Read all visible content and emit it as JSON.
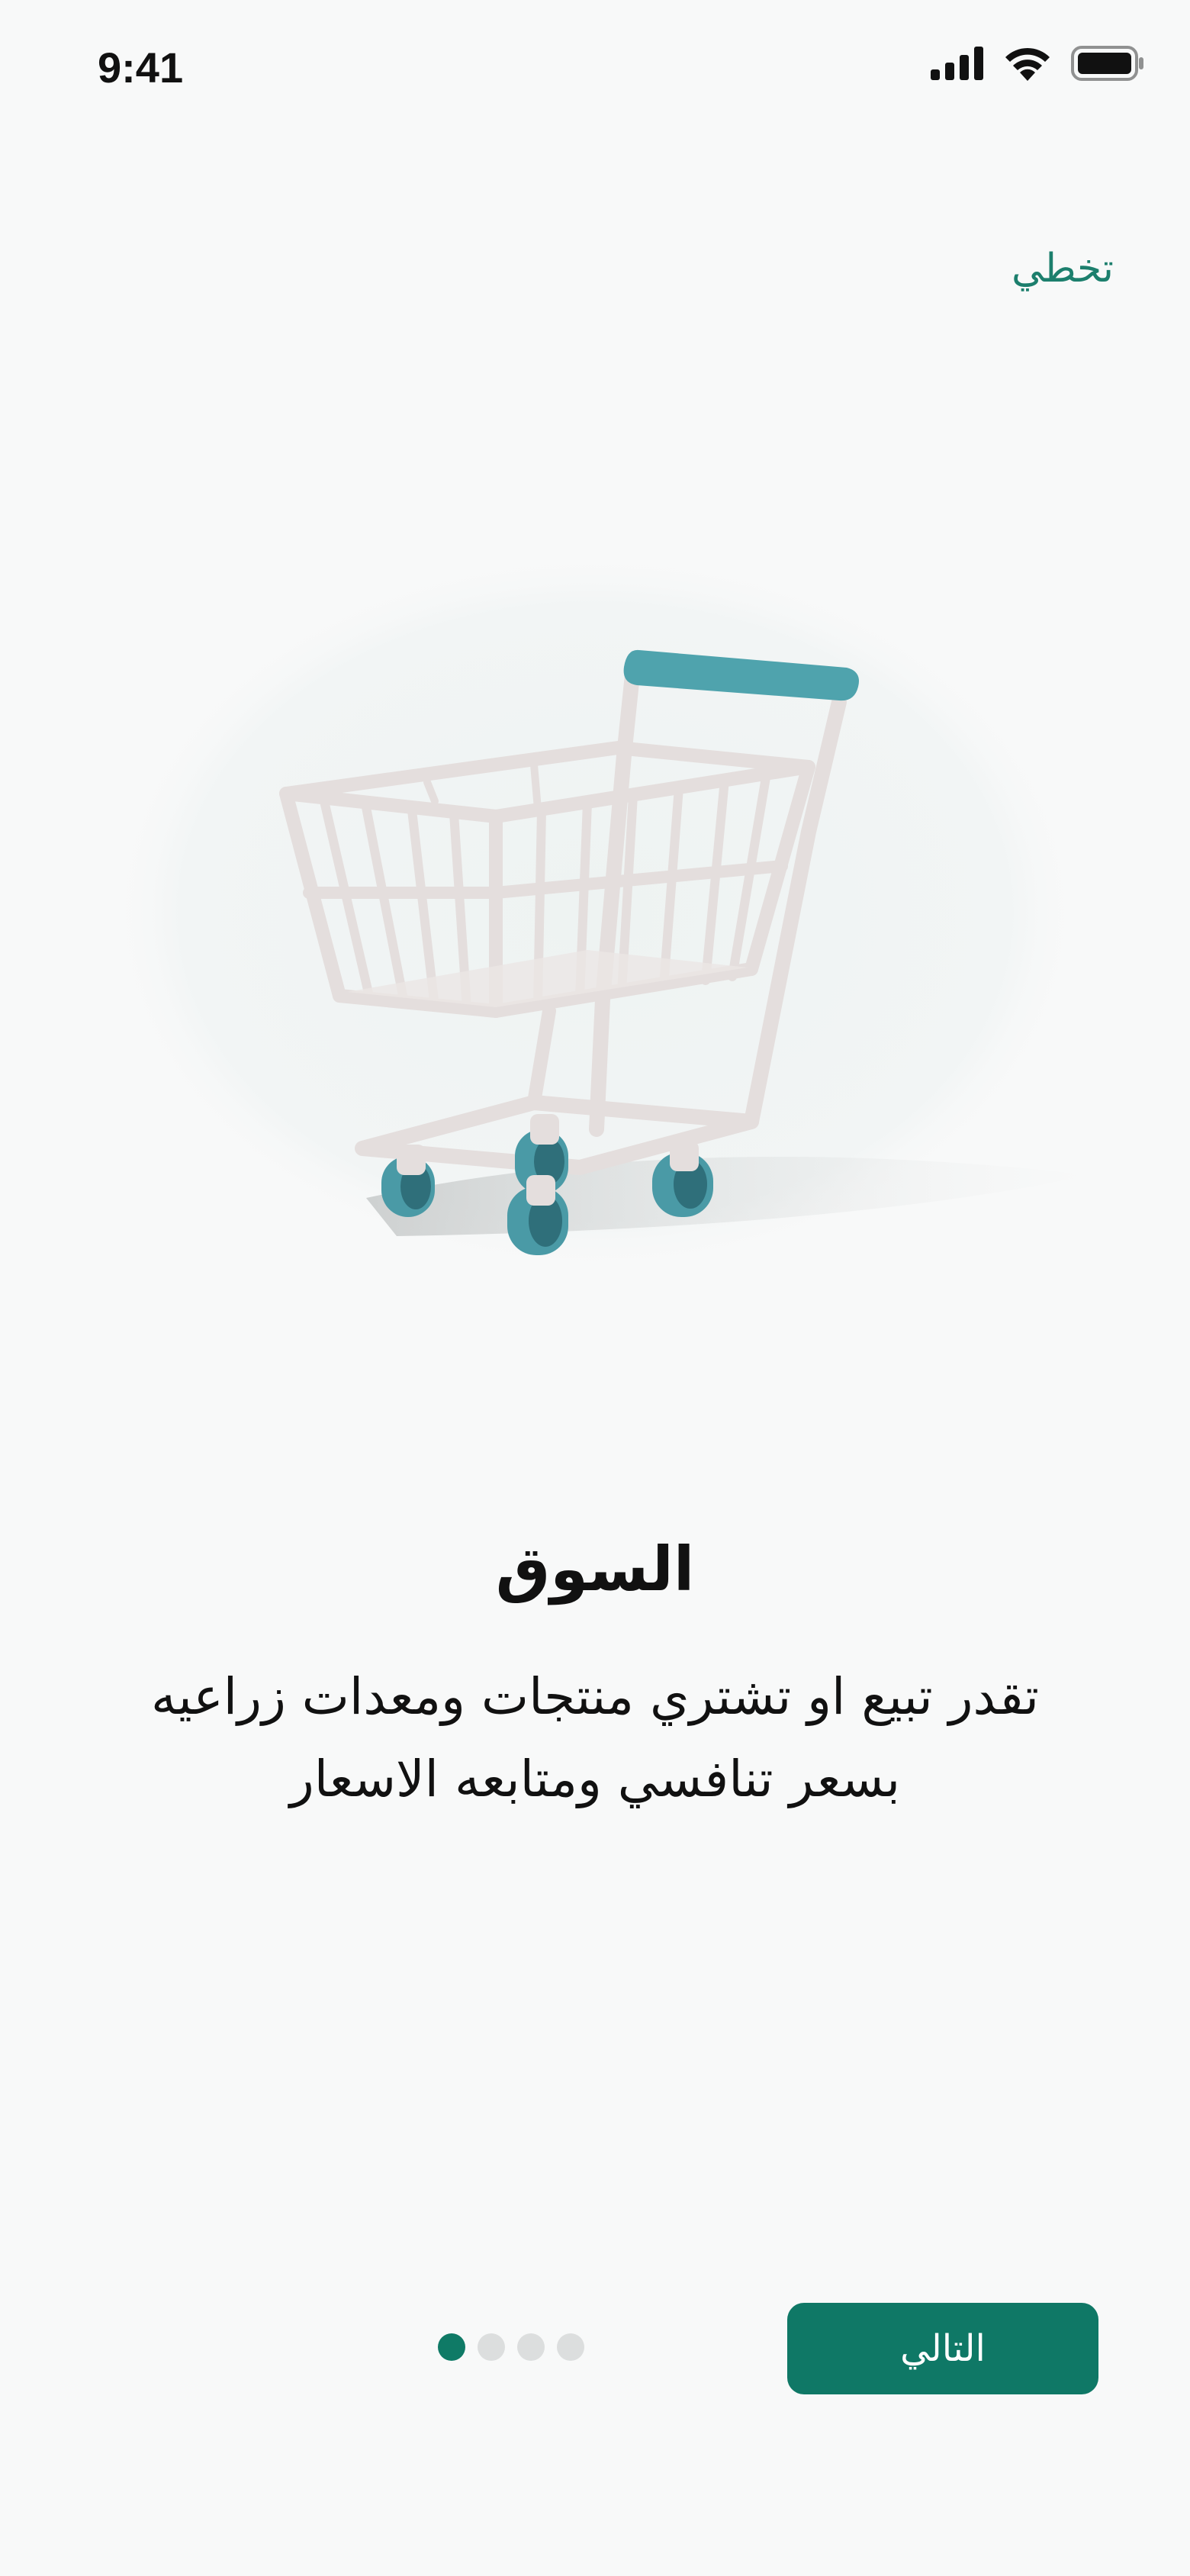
{
  "status_bar": {
    "time": "9:41",
    "icons": [
      "signal-icon",
      "wifi-icon",
      "battery-icon"
    ]
  },
  "onboarding": {
    "skip_label": "تخطي",
    "title": "السوق",
    "description": "تقدر تبيع او تشتري منتجات ومعدات زراعيه بسعر تنافسي ومتابعه الاسعار",
    "illustration": "shopping-cart-icon",
    "page_count": 4,
    "current_page": 1,
    "next_label": "التالي"
  },
  "colors": {
    "accent": "#0f7866",
    "background": "#f8f9f9",
    "dot_inactive": "#dcdede",
    "cart_handle": "#4fa3ad"
  }
}
